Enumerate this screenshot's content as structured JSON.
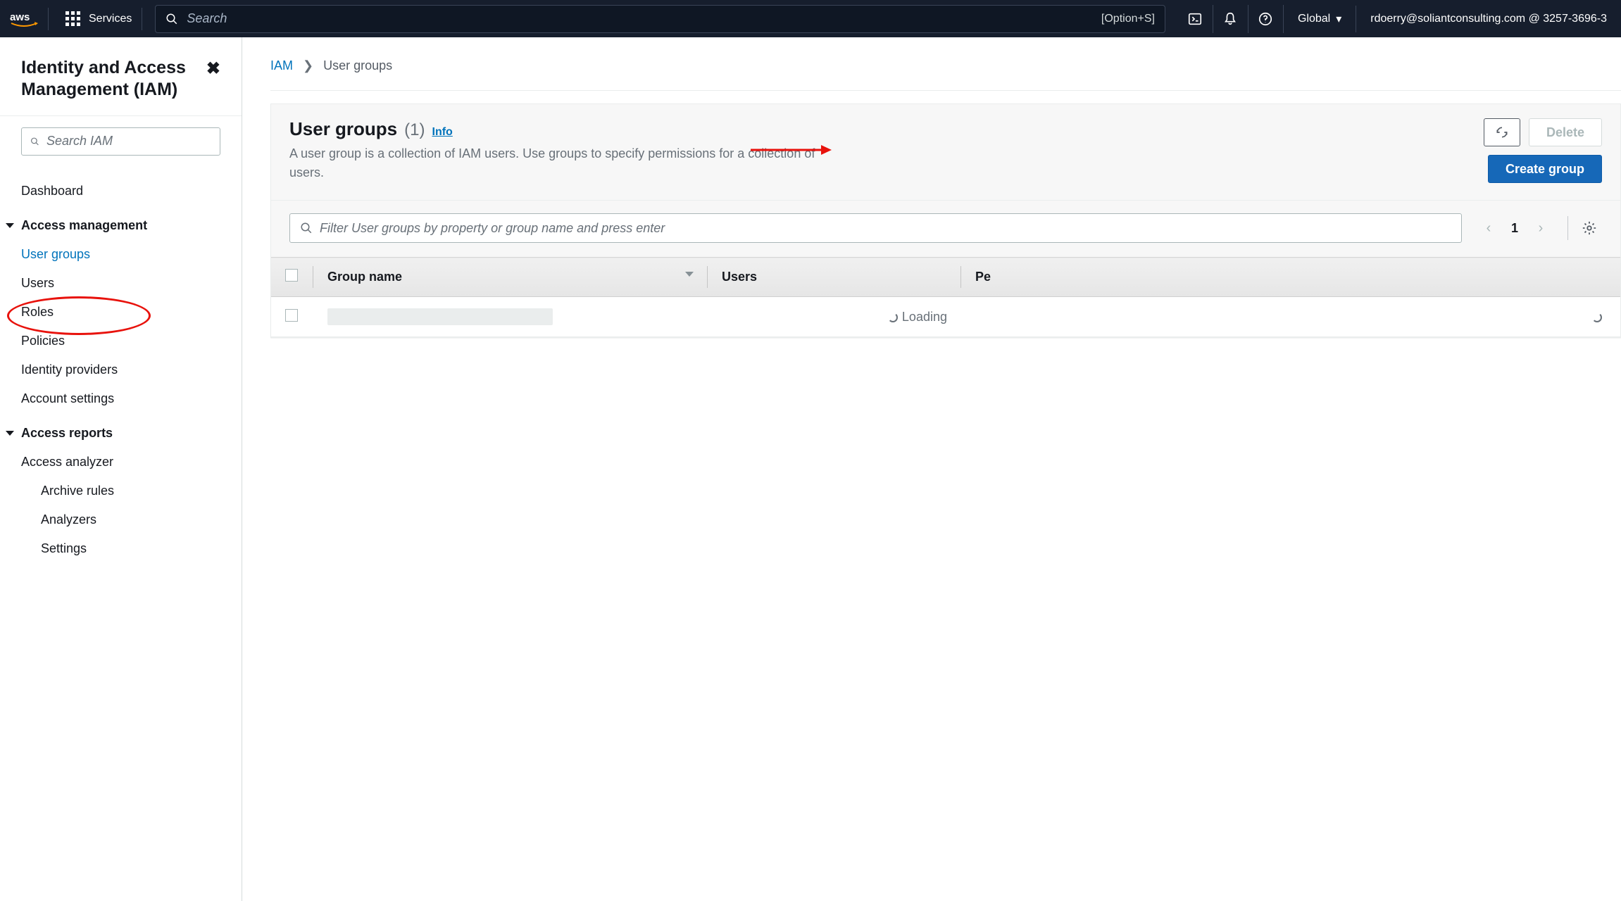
{
  "topnav": {
    "services_label": "Services",
    "search_placeholder": "Search",
    "search_shortcut": "[Option+S]",
    "region": "Global",
    "user_display": "rdoerry@soliantconsulting.com @ 3257-3696-3"
  },
  "sidebar": {
    "title": "Identity and Access Management (IAM)",
    "search_placeholder": "Search IAM",
    "items": {
      "dashboard": "Dashboard",
      "section_access": "Access management",
      "user_groups": "User groups",
      "users": "Users",
      "roles": "Roles",
      "policies": "Policies",
      "identity_providers": "Identity providers",
      "account_settings": "Account settings",
      "section_reports": "Access reports",
      "access_analyzer": "Access analyzer",
      "archive_rules": "Archive rules",
      "analyzers": "Analyzers",
      "settings": "Settings"
    }
  },
  "breadcrumb": {
    "iam": "IAM",
    "current": "User groups"
  },
  "panel": {
    "title": "User groups",
    "count": "(1)",
    "info_label": "Info",
    "description": "A user group is a collection of IAM users. Use groups to specify permissions for a collection of users.",
    "refresh_label": "",
    "delete_label": "Delete",
    "create_label": "Create group",
    "filter_placeholder": "Filter User groups by property or group name and press enter",
    "page_number": "1"
  },
  "table": {
    "columns": {
      "group_name": "Group name",
      "users": "Users",
      "permissions": "Pe"
    },
    "loading_label": "Loading"
  }
}
